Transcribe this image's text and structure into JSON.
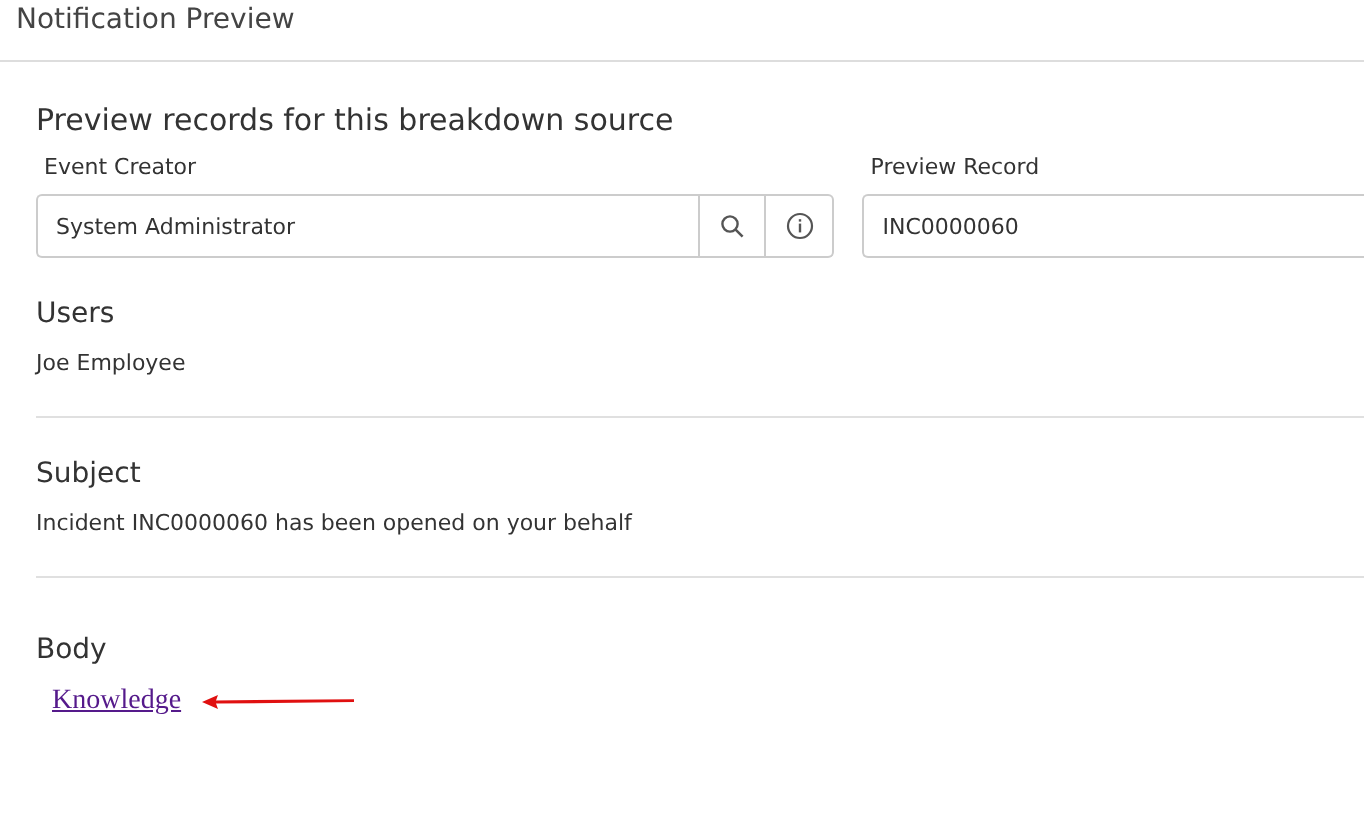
{
  "header": {
    "title": "Notification Preview"
  },
  "preview": {
    "heading": "Preview records for this breakdown source",
    "fields": [
      {
        "label": "Event Creator",
        "value": "System Administrator",
        "kind": "reference"
      },
      {
        "label": "Preview Record",
        "value": "INC0000060",
        "kind": "plain"
      }
    ]
  },
  "sections": [
    {
      "title": "Users",
      "text": "Joe Employee",
      "kind": "text"
    },
    {
      "title": "Subject",
      "text": "Incident INC0000060 has been opened on your behalf",
      "kind": "text"
    },
    {
      "title": "Body",
      "text": "Knowledge",
      "kind": "link"
    }
  ]
}
